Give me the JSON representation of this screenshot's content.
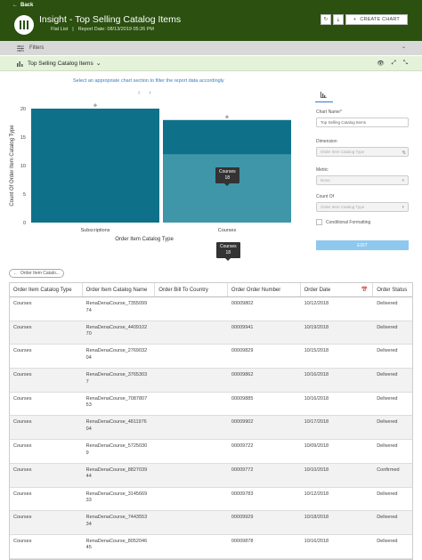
{
  "header": {
    "back_label": "Back",
    "title": "Insight - Top Selling Catalog Items",
    "view_type": "Flat List",
    "report_date": "Report Date:  08/13/2019 05:26 PM",
    "create_chart_label": "CREATE CHART"
  },
  "filters": {
    "label": "Filters"
  },
  "section": {
    "title": "Top Selling Catalog Items"
  },
  "hint": "Select an appropriate chart section to filter the report data accordingly",
  "chart_data": {
    "type": "bar",
    "categories": [
      "Subscriptions",
      "Courses"
    ],
    "values": [
      20,
      18
    ],
    "highlight_value": 12,
    "xlabel": "Order Item Catalog Type",
    "ylabel": "Count Of Order Item Catalog Type",
    "ylim": [
      0,
      20
    ],
    "yticks": [
      "0",
      "5",
      "10",
      "15",
      "20"
    ],
    "colors": {
      "bar": "#0f7189",
      "highlight": "#3e96a8"
    }
  },
  "tooltips": {
    "bar_tip_name": "Courses",
    "bar_tip_value": "18",
    "axis_tip_name": "Courses",
    "axis_tip_value": "18"
  },
  "panel": {
    "chart_name_label": "Chart Name*",
    "chart_name_value": "Top Selling Catalog Items",
    "dimension_label": "Dimension",
    "dimension_value": "Order Item Catalog Type",
    "metric_label": "Metric",
    "metric_value": "None",
    "count_of_label": "Count Of",
    "count_of_value": "Order Item Catalog Type",
    "conditional_label": "Conditional Formatting",
    "edit_label": "EDIT"
  },
  "chip": {
    "label": "Order Item Catalo..."
  },
  "table": {
    "columns": [
      "Order Item Catalog Type",
      "Order Item Catalog Name",
      "Order Bill To Country",
      "Order Order Number",
      "Order Date",
      "Order Status"
    ],
    "rows": [
      [
        "Courses",
        "RenaDenaCourse_7355099\n74",
        "",
        "00009802",
        "10/12/2018",
        "Delivered"
      ],
      [
        "Courses",
        "RenaDenaCourse_4409102\n70",
        "",
        "00009941",
        "10/19/2018",
        "Delivered"
      ],
      [
        "Courses",
        "RenaDenaCourse_2769032\n04",
        "",
        "00009829",
        "10/15/2018",
        "Delivered"
      ],
      [
        "Courses",
        "RenaDenaCourse_3765303\n7",
        "",
        "00009862",
        "10/16/2018",
        "Delivered"
      ],
      [
        "Courses",
        "RenaDenaCourse_7087807\n53",
        "",
        "00009885",
        "10/16/2018",
        "Delivered"
      ],
      [
        "Courses",
        "RenaDenaCourse_4811976\n04",
        "",
        "00009902",
        "10/17/2018",
        "Delivered"
      ],
      [
        "Courses",
        "RenaDenaCourse_5725030\n9",
        "",
        "00009722",
        "10/09/2018",
        "Delivered"
      ],
      [
        "Courses",
        "RenaDenaCourse_8827039\n44",
        "",
        "00009772",
        "10/10/2018",
        "Confirmed"
      ],
      [
        "Courses",
        "RenaDenaCourse_3145669\n33",
        "",
        "00009783",
        "10/12/2018",
        "Delivered"
      ],
      [
        "Courses",
        "RenaDenaCourse_7443553\n34",
        "",
        "00009929",
        "10/18/2018",
        "Delivered"
      ],
      [
        "Courses",
        "RenaDenaCourse_8052046\n45",
        "",
        "00009878",
        "10/16/2018",
        "Delivered"
      ]
    ]
  }
}
